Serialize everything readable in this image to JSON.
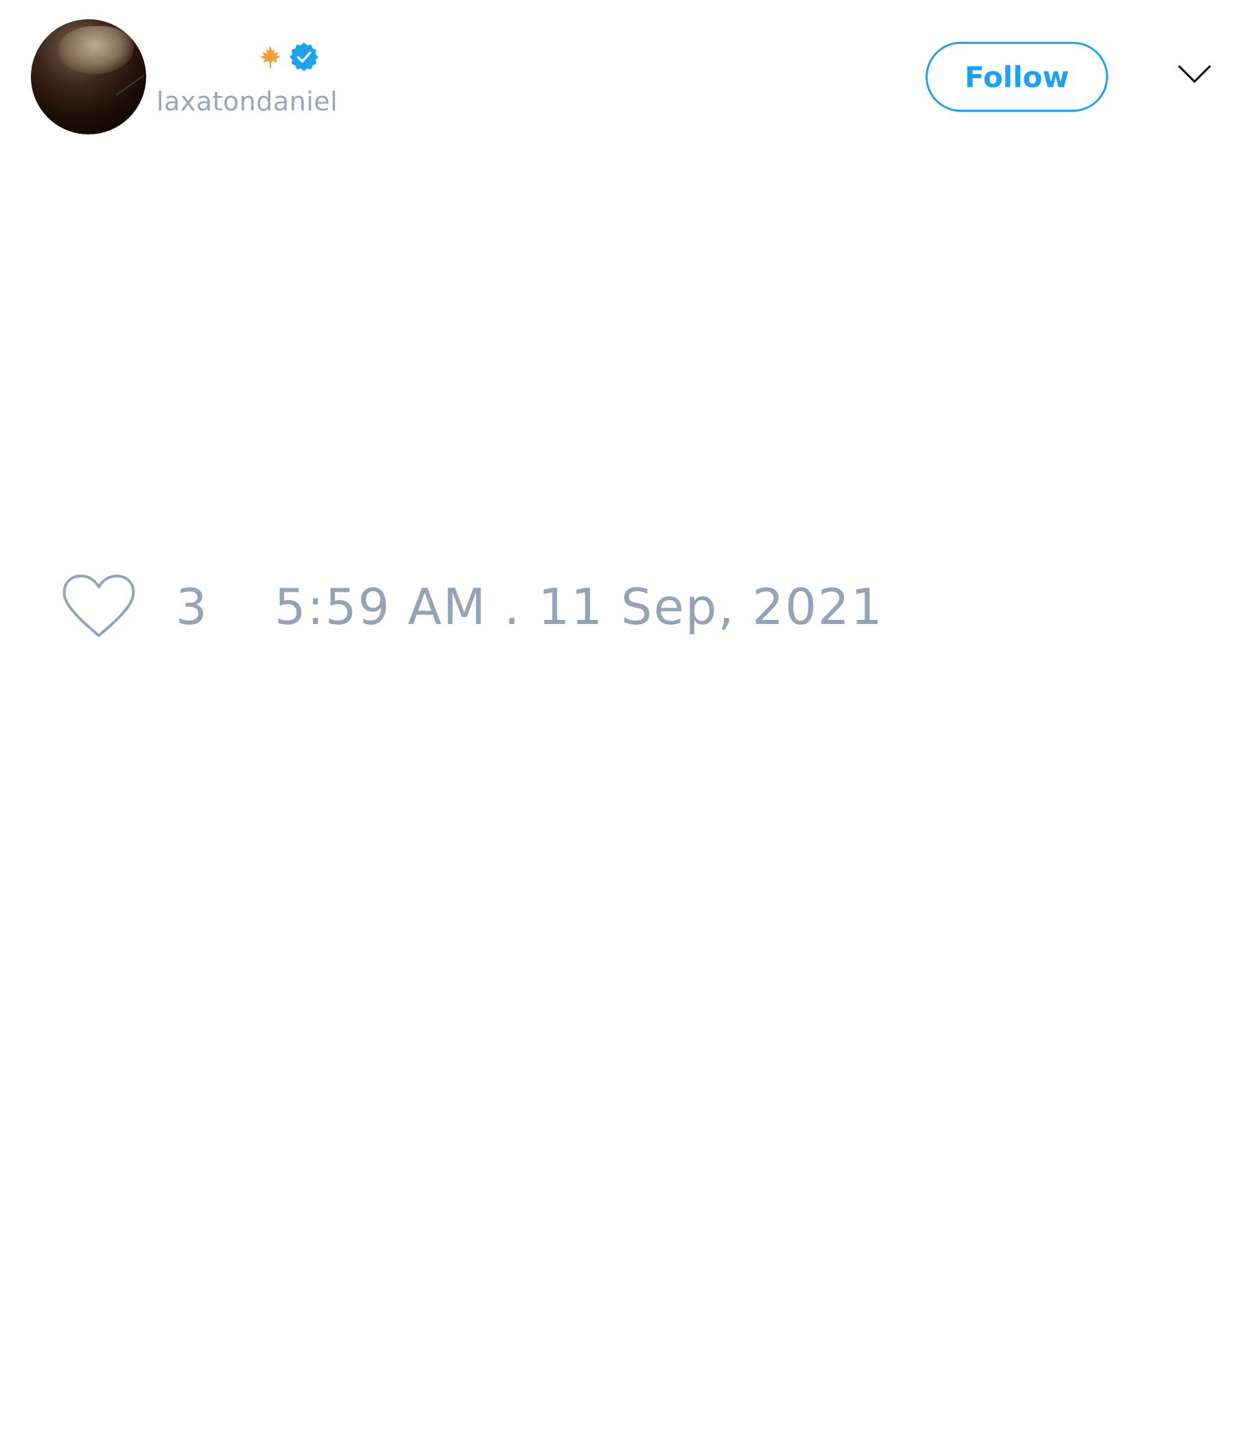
{
  "author": {
    "handle": "laxatondaniel",
    "avatar_icon": "profile-photo",
    "name_emoji": "maple-leaf-icon",
    "verified_icon": "verified-badge-icon",
    "verified_color": "#1da1f2"
  },
  "header": {
    "follow_label": "Follow",
    "menu_icon": "chevron-down-icon",
    "accent_color": "#1da1f2"
  },
  "tweet": {
    "like_icon": "heart-icon",
    "like_count": "3",
    "timestamp": "5:59 AM . 11 Sep, 2021",
    "meta_color": "#94a3b8"
  }
}
